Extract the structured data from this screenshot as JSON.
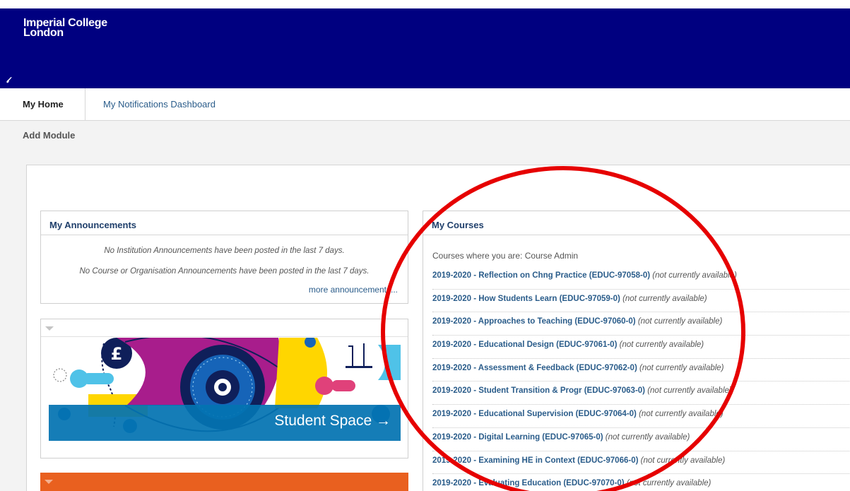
{
  "header": {
    "logo_line1": "Imperial College",
    "logo_line2": "London",
    "link_icon": "link-icon",
    "background_color": "#000080"
  },
  "tabs": [
    {
      "label": "My Home",
      "active": true
    },
    {
      "label": "My Notifications Dashboard",
      "active": false
    }
  ],
  "toolbar": {
    "add_module_label": "Add Module"
  },
  "announcements": {
    "title": "My Announcements",
    "institution_message": "No Institution Announcements have been posted in the last 7 days.",
    "course_message": "No Course or Organisation Announcements have been posted in the last 7 days.",
    "more_link": "more announcements..."
  },
  "courses": {
    "title": "My Courses",
    "role_label": "Courses where you are: Course Admin",
    "status_text": "(not currently available)",
    "items": [
      {
        "name": "2019-2020 - Reflection on Chng Practice (EDUC-97058-0)",
        "status": "(not currently available)"
      },
      {
        "name": "2019-2020 - How Students Learn (EDUC-97059-0)",
        "status": "(not currently available)"
      },
      {
        "name": "2019-2020 - Approaches to Teaching (EDUC-97060-0)",
        "status": "(not currently available)"
      },
      {
        "name": "2019-2020 - Educational Design (EDUC-97061-0)",
        "status": "(not currently available)"
      },
      {
        "name": "2019-2020 - Assessment & Feedback (EDUC-97062-0)",
        "status": "(not currently available)"
      },
      {
        "name": "2019-2020 - Student Transition & Progr (EDUC-97063-0)",
        "status": "(not currently available)"
      },
      {
        "name": "2019-2020 - Educational Supervision (EDUC-97064-0)",
        "status": "(not currently available)"
      },
      {
        "name": "2019-2020 - Digital Learning (EDUC-97065-0)",
        "status": "(not currently available)"
      },
      {
        "name": "2019-2020 - Examining HE in Context (EDUC-97066-0)",
        "status": "(not currently available)"
      },
      {
        "name": "2019-2020 - Evaluating Education (EDUC-97070-0)",
        "status": "(not currently available)"
      }
    ]
  },
  "student_space": {
    "label": "Student Space →",
    "icon": "pound-icon",
    "bar_color": "#0373b2"
  },
  "annotation": {
    "color": "#e60000"
  },
  "colors": {
    "link": "#2a5c8a",
    "panel_heading": "#1f3f6b",
    "orange_panel": "#e9601f",
    "content_background": "#f3f3f3"
  }
}
